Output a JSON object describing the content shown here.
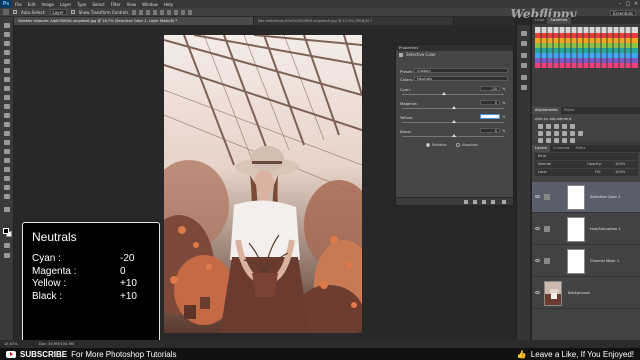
{
  "app": {
    "logo": "Ps"
  },
  "menubar": {
    "items": [
      "File",
      "Edit",
      "Image",
      "Layer",
      "Type",
      "Select",
      "Filter",
      "View",
      "Window",
      "Help"
    ]
  },
  "options": {
    "auto_select_label": "Auto-Select:",
    "auto_select_value": "Layer",
    "transform_label": "Show Transform Controls",
    "workspace": "Essentials"
  },
  "watermark": "Webflippy",
  "tabs": [
    {
      "label": "Selektiv ohjaude: AlphOSKOIa umpekoit.jpg @ 16.7% (Selective Color 1, Layer Mask/8) *",
      "active": true
    },
    {
      "label": "Ilde ehdotmot-XOXOkOKOMKB umpekolt.jpg @ 17.5% (RGB/8) *",
      "active": false
    }
  ],
  "neutrals": {
    "title": "Neutrals",
    "rows": [
      {
        "key": "Cyan :",
        "value": "-20"
      },
      {
        "key": "Magenta :",
        "value": "0"
      },
      {
        "key": "Yellow :",
        "value": "+10"
      },
      {
        "key": "Black :",
        "value": "+10"
      }
    ]
  },
  "properties": {
    "header": "Properties",
    "subtitle": "Selective Color",
    "preset_label": "Preset:",
    "preset_value": "Custom",
    "colors_label": "Colors:",
    "colors_value": "Neutrals",
    "cyan_label": "Cyan:",
    "cyan_value": "-20",
    "magenta_label": "Magenta:",
    "magenta_value": "0",
    "yellow_label": "Yellow:",
    "yellow_value": "",
    "black_label": "Black:",
    "black_value": "0",
    "pct": "%",
    "relative_label": "Relative",
    "absolute_label": "Absolute"
  },
  "dock": {
    "swatch_tabs": [
      "Color",
      "Swatches"
    ],
    "adjust_tabs": [
      "Adjustments",
      "Styles"
    ],
    "adjust_title": "Add an adjustment",
    "layer_tabs": [
      "Layers",
      "Channels",
      "Paths"
    ],
    "kind_label": "Kind",
    "blend_mode": "Normal",
    "opacity_label": "Opacity:",
    "opacity_value": "100%",
    "lock_label": "Lock:",
    "fill_label": "Fill:",
    "fill_value": "100%",
    "layers": [
      {
        "name": "Selective Color 1",
        "selected": true
      },
      {
        "name": "Hue/Saturation 1",
        "selected": false
      },
      {
        "name": "Channel Mixer 1",
        "selected": false
      },
      {
        "name": "Background",
        "selected": false
      }
    ]
  },
  "status": {
    "zoom": "16.67%",
    "doc": "Doc: 34.9M/104.9M"
  },
  "banner": {
    "subscribe_bold": "SUBSCRIBE",
    "subscribe_rest": "For More Photoshop Tutorials",
    "like_text": "Leave a Like, If You Enjoyed!"
  },
  "colors": {
    "accent": "#5fb6ff",
    "selected_layer": "#5a5e6b",
    "youtube_red": "#e00000"
  }
}
